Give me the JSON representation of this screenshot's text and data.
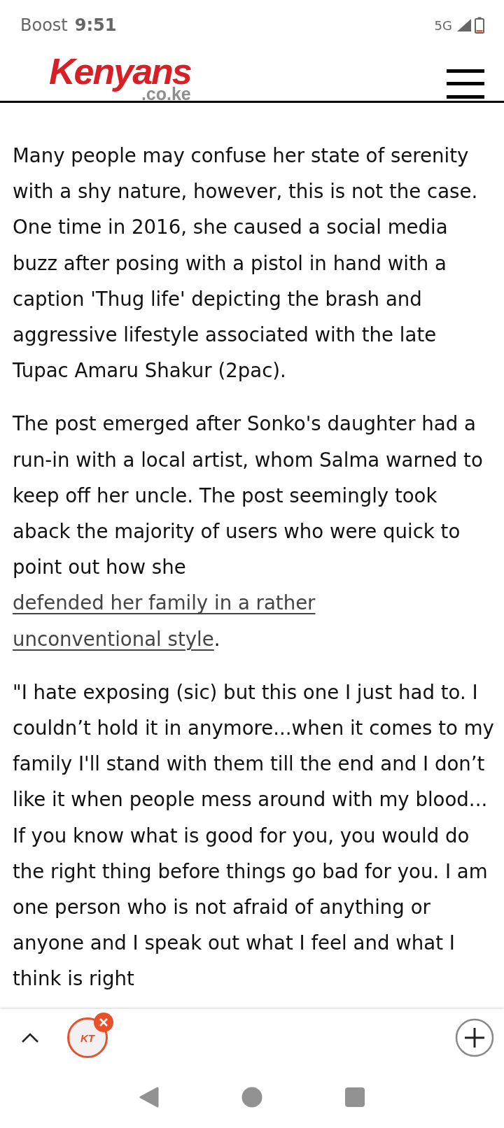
{
  "status_bar": {
    "carrier": "Boost",
    "time": "9:51",
    "network": "5G"
  },
  "header": {
    "logo_main": "Kenyans",
    "logo_domain": ".co.ke"
  },
  "article": {
    "paragraphs": [
      {
        "text": "Many people may confuse her state of serenity with a shy nature, however, this is not the case. One time in 2016, she caused a social media buzz after posing with a pistol in hand with a caption 'Thug life' depicting the brash and aggressive lifestyle associated with the late Tupac Amaru Shakur (2pac)."
      },
      {
        "text": "The post emerged after Sonko's daughter had a run-in with a local artist, whom Salma warned to keep off her uncle. The post seemingly took aback the majority of users who were quick to point out how she",
        "link": [
          "defended her family in a rather",
          "unconventional style"
        ],
        "after": "."
      },
      {
        "text": "\"I hate exposing (sic) but this one I just had to. I couldn’t hold it in anymore...when it comes to my family I'll stand with them till the end and I don’t like it when people mess around with my blood... If you know what is good for you, you would do the right thing before things go bad for you. I am one person who is not afraid of anything or anyone and I speak out what I feel and what I think is right"
      }
    ]
  },
  "bottom_bar": {
    "tab_logo": "KT"
  }
}
